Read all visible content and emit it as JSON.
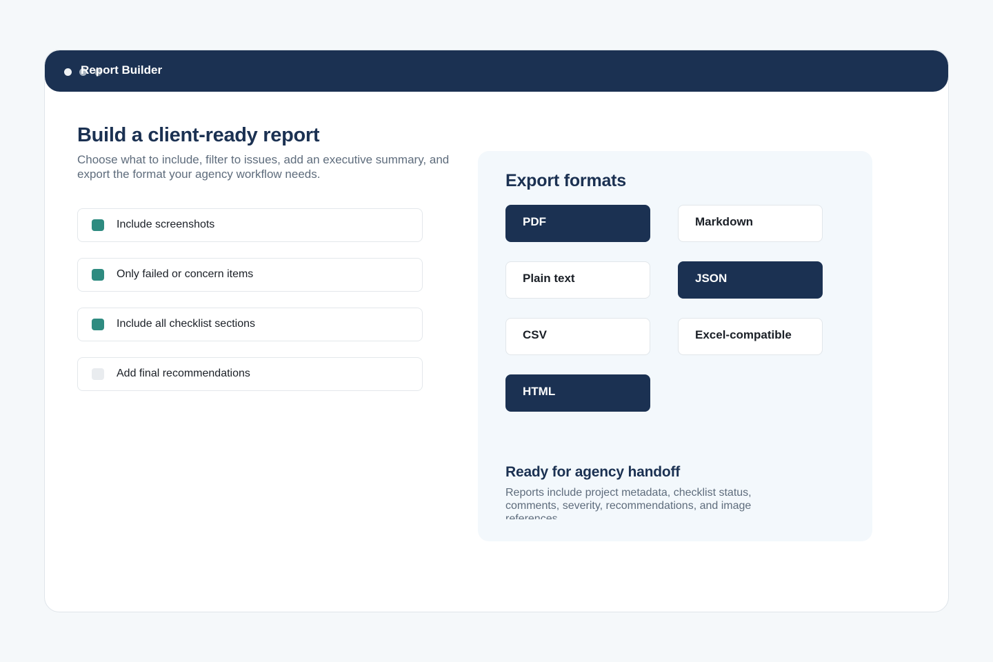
{
  "window": {
    "title": "Report Builder"
  },
  "header": {
    "title": "Build a client-ready report",
    "subtitle": "Choose what to include, filter to issues, add an executive summary, and export the format your agency workflow needs."
  },
  "options": [
    {
      "label": "Include screenshots",
      "checked": true
    },
    {
      "label": "Only failed or concern items",
      "checked": true
    },
    {
      "label": "Include all checklist sections",
      "checked": true
    },
    {
      "label": "Add final recommendations",
      "checked": false
    }
  ],
  "export": {
    "title": "Export formats",
    "formats": [
      {
        "label": "PDF",
        "selected": true
      },
      {
        "label": "Markdown",
        "selected": false
      },
      {
        "label": "Plain text",
        "selected": false
      },
      {
        "label": "JSON",
        "selected": true
      },
      {
        "label": "CSV",
        "selected": false
      },
      {
        "label": "Excel-compatible",
        "selected": false
      },
      {
        "label": "HTML",
        "selected": true
      }
    ]
  },
  "handoff": {
    "title": "Ready for agency handoff",
    "text": "Reports include project metadata, checklist status, comments, severity, recommendations, and image references."
  },
  "colors": {
    "navy": "#1b3152",
    "teal_check": "#2e8b80",
    "muted_text": "#5e6c7c",
    "panel_bg": "#f3f8fc"
  }
}
